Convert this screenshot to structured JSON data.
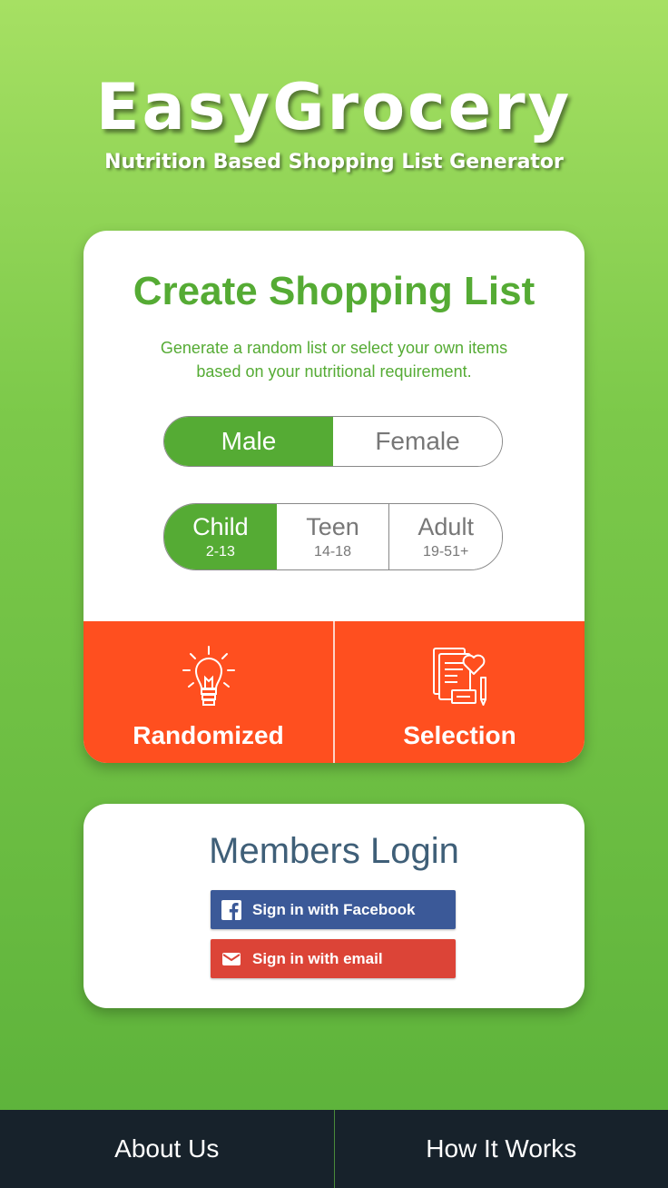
{
  "app": {
    "title": "EasyGrocery",
    "subtitle": "Nutrition Based Shopping List Generator"
  },
  "create": {
    "title": "Create Shopping List",
    "description_line1": "Generate a random list or select your own items",
    "description_line2": "based on your nutritional requirement.",
    "gender_options": [
      {
        "label": "Male",
        "selected": true
      },
      {
        "label": "Female",
        "selected": false
      }
    ],
    "age_options": [
      {
        "label": "Child",
        "range": "2-13",
        "selected": true
      },
      {
        "label": "Teen",
        "range": "14-18",
        "selected": false
      },
      {
        "label": "Adult",
        "range": "19-51+",
        "selected": false
      }
    ],
    "actions": [
      {
        "label": "Randomized",
        "icon": "lightbulb-icon"
      },
      {
        "label": "Selection",
        "icon": "list-heart-icon"
      }
    ]
  },
  "login": {
    "title": "Members Login",
    "facebook_label": "Sign in with Facebook",
    "email_label": "Sign in with email"
  },
  "footer": {
    "items": [
      {
        "label": "About Us"
      },
      {
        "label": "How It Works"
      }
    ]
  },
  "colors": {
    "green": "#55ab34",
    "orange": "#ff4f1f",
    "facebook": "#3b5998",
    "email": "#dc4437",
    "footer": "#17222b"
  }
}
